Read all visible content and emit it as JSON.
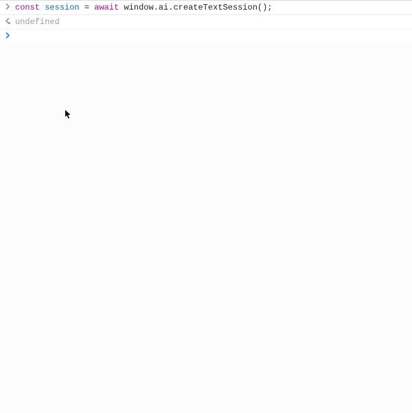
{
  "console": {
    "entries": [
      {
        "kind": "input",
        "tokens": [
          {
            "t": "const",
            "cls": "tok-keyword"
          },
          {
            "t": " ",
            "cls": "tok-default"
          },
          {
            "t": "session",
            "cls": "tok-ident"
          },
          {
            "t": " = ",
            "cls": "tok-default"
          },
          {
            "t": "await",
            "cls": "tok-keyword2"
          },
          {
            "t": " window.ai.createTextSession();",
            "cls": "tok-default"
          }
        ]
      },
      {
        "kind": "output",
        "text": "undefined"
      }
    ],
    "prompt_value": ""
  }
}
